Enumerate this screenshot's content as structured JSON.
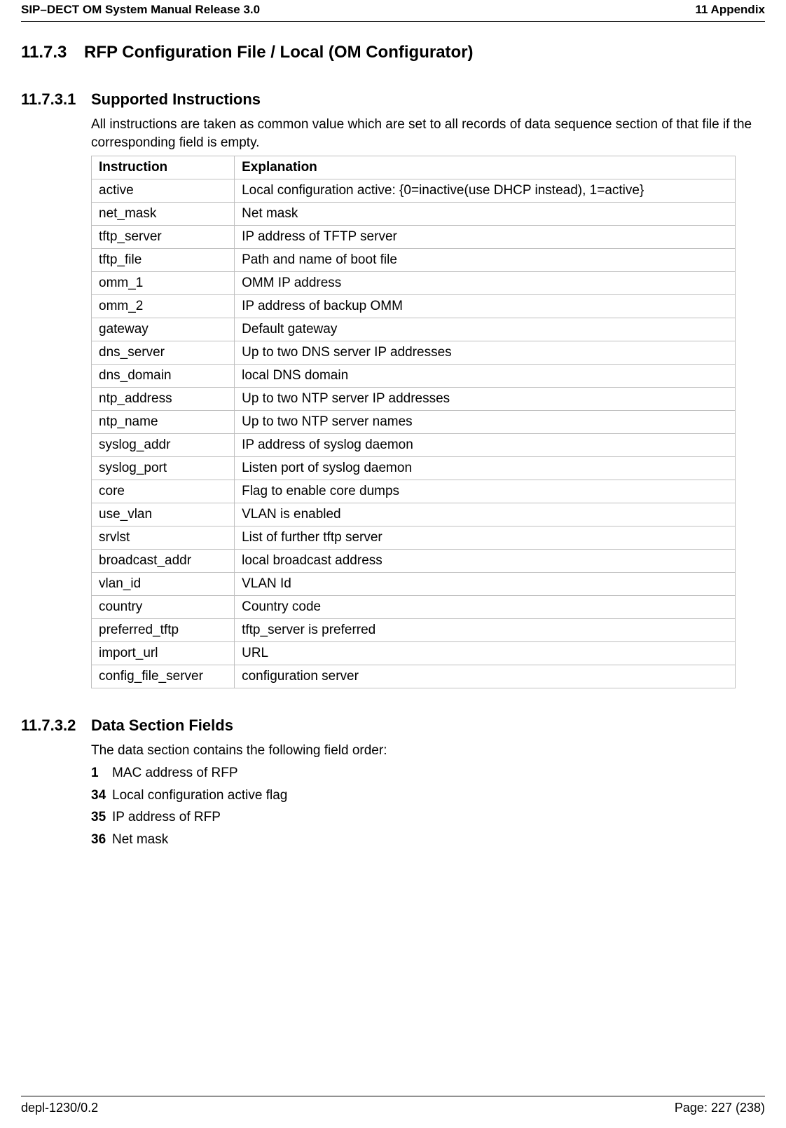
{
  "header": {
    "left": "SIP–DECT OM System Manual Release 3.0",
    "right": "11 Appendix"
  },
  "sections": {
    "s1": {
      "num": "11.7.3",
      "title": "RFP Configuration File / Local (OM Configurator)"
    },
    "s2": {
      "num": "11.7.3.1",
      "title": "Supported Instructions",
      "para": "All instructions are taken as common value which are set to all records of data sequence section of that file if the corresponding field is empty."
    },
    "s3": {
      "num": "11.7.3.2",
      "title": "Data Section Fields",
      "para": "The data section contains the following field order:"
    }
  },
  "table": {
    "h1": "Instruction",
    "h2": "Explanation",
    "rows": [
      {
        "c1": "active",
        "c2": "Local configuration active: {0=inactive(use DHCP instead), 1=active}"
      },
      {
        "c1": "net_mask",
        "c2": "Net mask"
      },
      {
        "c1": "tftp_server",
        "c2": "IP address of TFTP server"
      },
      {
        "c1": "tftp_file",
        "c2": "Path and name of boot file"
      },
      {
        "c1": "omm_1",
        "c2": "OMM IP address"
      },
      {
        "c1": "omm_2",
        "c2": "IP address of backup OMM"
      },
      {
        "c1": "gateway",
        "c2": "Default gateway"
      },
      {
        "c1": "dns_server",
        "c2": "Up to two DNS server IP addresses"
      },
      {
        "c1": "dns_domain",
        "c2": "local DNS domain"
      },
      {
        "c1": "ntp_address",
        "c2": "Up to two NTP server IP addresses"
      },
      {
        "c1": "ntp_name",
        "c2": "Up to two NTP server names"
      },
      {
        "c1": "syslog_addr",
        "c2": "IP address of syslog daemon"
      },
      {
        "c1": "syslog_port",
        "c2": "Listen port of syslog daemon"
      },
      {
        "c1": "core",
        "c2": "Flag to enable core dumps"
      },
      {
        "c1": "use_vlan",
        "c2": "VLAN is enabled"
      },
      {
        "c1": "srvlst",
        "c2": "List of further tftp server"
      },
      {
        "c1": "broadcast_addr",
        "c2": "local broadcast address"
      },
      {
        "c1": "vlan_id",
        "c2": "VLAN Id"
      },
      {
        "c1": "country",
        "c2": "Country code"
      },
      {
        "c1": "preferred_tftp",
        "c2": "tftp_server is preferred"
      },
      {
        "c1": "import_url",
        "c2": "URL"
      },
      {
        "c1": "config_file_server",
        "c2": "configuration server"
      }
    ]
  },
  "list": [
    {
      "mk": "1",
      "txt": "MAC address of RFP"
    },
    {
      "mk": "34",
      "txt": "Local configuration active flag"
    },
    {
      "mk": "35",
      "txt": "IP address of RFP"
    },
    {
      "mk": "36",
      "txt": "Net mask"
    }
  ],
  "footer": {
    "left": "depl-1230/0.2",
    "right": "Page: 227 (238)"
  }
}
